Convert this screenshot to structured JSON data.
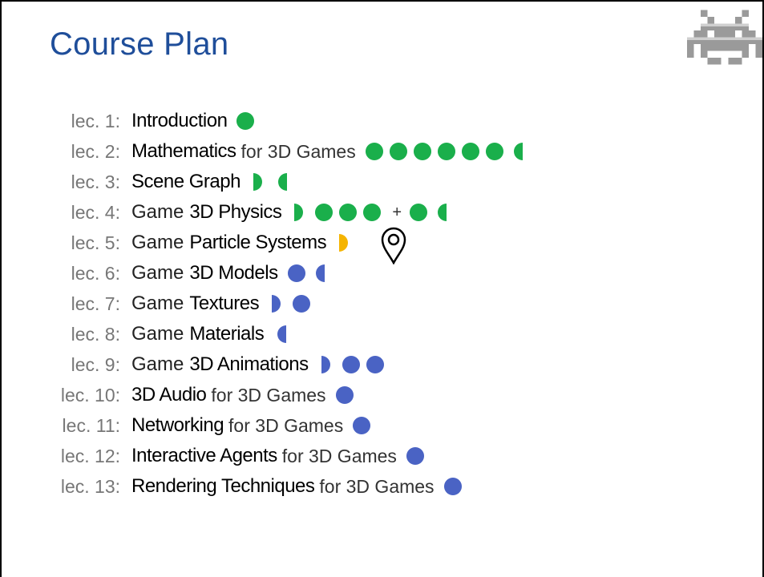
{
  "title": "Course Plan",
  "colors": {
    "green": "#1aaf4b",
    "blue": "#4a63c4",
    "yellow": "#f5b400",
    "title": "#1f4e9a"
  },
  "lectures": [
    {
      "num": "lec. 1:",
      "pre": "",
      "key": "Introduction",
      "post": "",
      "marks": [
        [
          "full"
        ]
      ],
      "color": "green"
    },
    {
      "num": "lec. 2:",
      "pre": "",
      "key": "Mathematics",
      "post": "for 3D Games",
      "marks": [
        [
          "full",
          "full",
          "full",
          "full",
          "full",
          "full",
          "left"
        ]
      ],
      "color": "green"
    },
    {
      "num": "lec. 3:",
      "pre": "",
      "key": "Scene Graph",
      "post": "",
      "marks": [
        [
          "right",
          "left"
        ]
      ],
      "color": "green"
    },
    {
      "num": "lec. 4:",
      "pre": "Game",
      "key": "3D Physics",
      "post": "",
      "marks": [
        [
          "right",
          "full",
          "full",
          "full"
        ],
        [
          "full",
          "left"
        ]
      ],
      "color": "green"
    },
    {
      "num": "lec. 5:",
      "pre": "Game",
      "key": "Particle Systems",
      "post": "",
      "marks": [
        [
          "right"
        ]
      ],
      "color": "yellow"
    },
    {
      "num": "lec. 6:",
      "pre": "Game",
      "key": "3D Models",
      "post": "",
      "marks": [
        [
          "full",
          "left"
        ]
      ],
      "color": "blue"
    },
    {
      "num": "lec. 7:",
      "pre": "Game",
      "key": "Textures",
      "post": "",
      "marks": [
        [
          "right",
          "full"
        ]
      ],
      "color": "blue"
    },
    {
      "num": "lec. 8:",
      "pre": "Game",
      "key": "Materials",
      "post": "",
      "marks": [
        [
          "left"
        ]
      ],
      "color": "blue"
    },
    {
      "num": "lec. 9:",
      "pre": "Game",
      "key": "3D Animations",
      "post": "",
      "marks": [
        [
          "right",
          "full",
          "full"
        ]
      ],
      "color": "blue"
    },
    {
      "num": "lec. 10:",
      "pre": "",
      "key": "3D Audio",
      "post": "for 3D Games",
      "marks": [
        [
          "full"
        ]
      ],
      "color": "blue"
    },
    {
      "num": "lec. 11:",
      "pre": "",
      "key": "Networking",
      "post": "for 3D Games",
      "marks": [
        [
          "full"
        ]
      ],
      "color": "blue"
    },
    {
      "num": "lec. 12:",
      "pre": "",
      "key": "Interactive Agents",
      "post": "for 3D Games",
      "marks": [
        [
          "full"
        ]
      ],
      "color": "blue"
    },
    {
      "num": "lec. 13:",
      "pre": "",
      "key": "Rendering Techniques",
      "post": "for 3D Games",
      "marks": [
        [
          "full"
        ]
      ],
      "color": "blue"
    }
  ],
  "plus_sign": "+",
  "icons": {
    "mascot": "space-invader-icon",
    "cursor": "location-pin-icon"
  }
}
